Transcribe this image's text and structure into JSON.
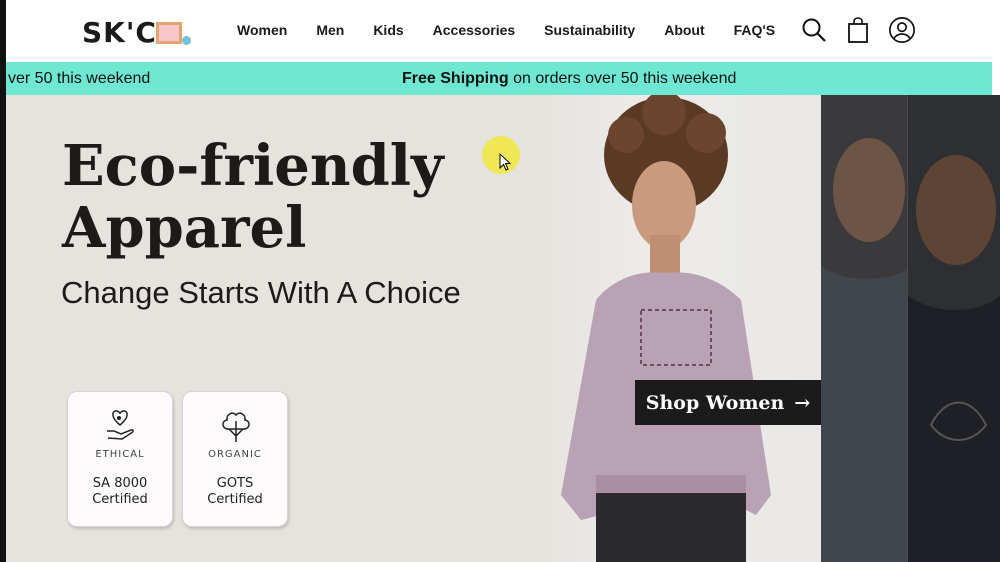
{
  "header": {
    "logo_text": "SK'CH",
    "nav": [
      {
        "label": "Women"
      },
      {
        "label": "Men"
      },
      {
        "label": "Kids"
      },
      {
        "label": "Accessories"
      },
      {
        "label": "Sustainability"
      },
      {
        "label": "About"
      },
      {
        "label": "FAQ'S"
      }
    ],
    "icons": [
      "search-icon",
      "shopping-bag-icon",
      "account-icon"
    ]
  },
  "announcement": {
    "left_fragment": "ver 50 this weekend",
    "bold": "Free Shipping",
    "rest": " on orders over 50 this weekend"
  },
  "hero": {
    "headline_line1": "Eco-friendly",
    "headline_line2": "Apparel",
    "subheadline": "Change Starts With A Choice",
    "cta_label": "Shop Women",
    "cta_arrow": "→",
    "badges": [
      {
        "icon": "ethical-heart-hand-icon",
        "type": "ETHICAL",
        "value_line1": "SA 8000",
        "value_line2": "Certified"
      },
      {
        "icon": "organic-cotton-icon",
        "type": "ORGANIC",
        "value_line1": "GOTS",
        "value_line2": "Certified"
      }
    ]
  },
  "colors": {
    "announcement_bg": "#6ee8d2",
    "hero_bg": "#e6e3de",
    "cta_bg": "#1b1b1b",
    "sweater": "#b9a2b4"
  }
}
